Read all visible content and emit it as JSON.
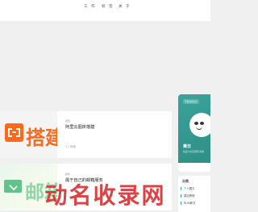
{
  "nav": {
    "items": [
      {
        "label": "工 作"
      },
      {
        "label": "标 签"
      },
      {
        "label": "关 于"
      }
    ]
  },
  "posts": [
    {
      "thumb_text": "搭建",
      "category": "搭建",
      "title": "阿里云图床搭建",
      "meta": "1 / 页面"
    },
    {
      "thumb_text": "邮箱",
      "category": "邮件",
      "title": "属于自己的邮箱服务",
      "meta": ""
    }
  ],
  "author": {
    "tag": "不要去哈哈大",
    "name": "黄日",
    "bio": "热爱可以抵消所有的难"
  },
  "categories": {
    "header": "分类",
    "items": [
      {
        "label": "个人圆文"
      },
      {
        "label": "建站教程"
      },
      {
        "label": "BUG解决"
      }
    ]
  },
  "watermark": {
    "text": "动名收录网"
  },
  "colors": {
    "accent": "#3aa39a",
    "brand_orange": "#ff6a1a",
    "watermark": "#d82727"
  }
}
